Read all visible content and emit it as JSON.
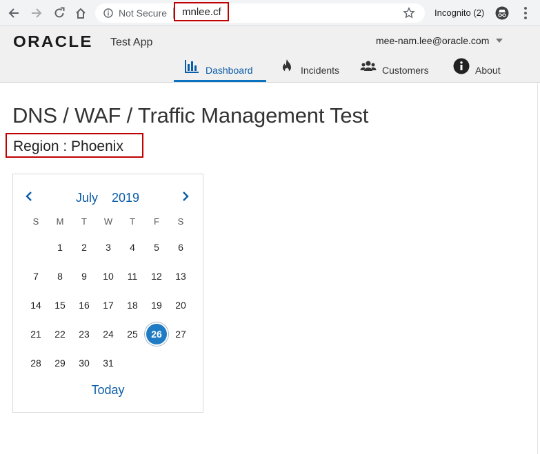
{
  "browser": {
    "security_label": "Not Secure",
    "url": "mnlee.cf",
    "incognito_label": "Incognito (2)"
  },
  "header": {
    "logo_text": "ORACLE",
    "app_name": "Test App",
    "user_email": "mee-nam.lee@oracle.com",
    "nav": [
      {
        "label": "Dashboard",
        "icon": "bar-chart-icon",
        "active": true
      },
      {
        "label": "Incidents",
        "icon": "fire-icon",
        "active": false
      },
      {
        "label": "Customers",
        "icon": "people-icon",
        "active": false
      },
      {
        "label": "About",
        "icon": "info-icon",
        "active": false
      }
    ]
  },
  "page": {
    "title": "DNS / WAF / Traffic Management Test",
    "region": "Region : Phoenix"
  },
  "calendar": {
    "month": "July",
    "year": "2019",
    "weekdays": [
      "S",
      "M",
      "T",
      "W",
      "T",
      "F",
      "S"
    ],
    "first_weekday_index": 1,
    "days_in_month": 31,
    "selected_day": 26,
    "today_label": "Today"
  },
  "colors": {
    "accent": "#0b5ca8",
    "selected_day": "#1f7cc4",
    "highlight_border": "#c00000"
  }
}
